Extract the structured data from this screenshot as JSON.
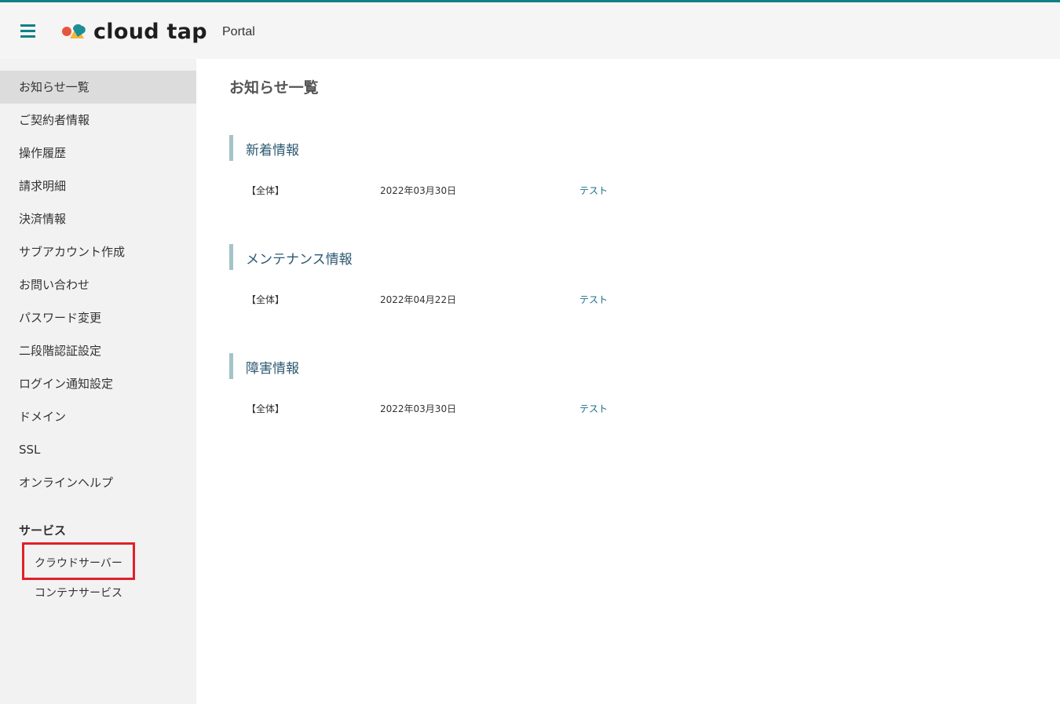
{
  "colors": {
    "accent": "#0f7f86",
    "section_bar": "#a3c4c9",
    "section_heading": "#2e5a72",
    "link": "#1a6f8a",
    "highlight": "#e0202a"
  },
  "header": {
    "brand": "cloud tap",
    "portal_label": "Portal",
    "menu_icon": "hamburger-icon"
  },
  "sidebar": {
    "items": [
      {
        "label": "お知らせ一覧"
      },
      {
        "label": "ご契約者情報"
      },
      {
        "label": "操作履歴"
      },
      {
        "label": "請求明細"
      },
      {
        "label": "決済情報"
      },
      {
        "label": "サブアカウント作成"
      },
      {
        "label": "お問い合わせ"
      },
      {
        "label": "パスワード変更"
      },
      {
        "label": "二段階認証設定"
      },
      {
        "label": "ログイン通知設定"
      },
      {
        "label": "ドメイン"
      },
      {
        "label": "SSL"
      },
      {
        "label": "オンラインヘルプ"
      }
    ],
    "active_index": 0,
    "services_title": "サービス",
    "services": [
      {
        "label": "クラウドサーバー"
      },
      {
        "label": "コンテナサービス"
      }
    ]
  },
  "main": {
    "title": "お知らせ一覧",
    "sections": [
      {
        "heading": "新着情報",
        "rows": [
          {
            "category": "【全体】",
            "date": "2022年03月30日",
            "link": "テスト"
          }
        ]
      },
      {
        "heading": "メンテナンス情報",
        "rows": [
          {
            "category": "【全体】",
            "date": "2022年04月22日",
            "link": "テスト"
          }
        ]
      },
      {
        "heading": "障害情報",
        "rows": [
          {
            "category": "【全体】",
            "date": "2022年03月30日",
            "link": "テスト"
          }
        ]
      }
    ]
  }
}
